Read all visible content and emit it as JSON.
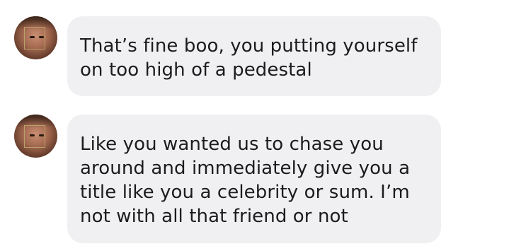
{
  "messages": [
    {
      "sender_avatar": "profile-photo",
      "text": "That’s fine boo, you putting yourself\non too high of a pedestal"
    },
    {
      "sender_avatar": "profile-photo",
      "text": "Like you wanted us to chase you\naround and immediately give you a\ntitle like you a celebrity or sum. I’m\nnot with all that friend or not"
    }
  ],
  "colors": {
    "bubble_background": "#f0f0f2",
    "text": "#1c1c1e",
    "page_background": "#ffffff"
  }
}
